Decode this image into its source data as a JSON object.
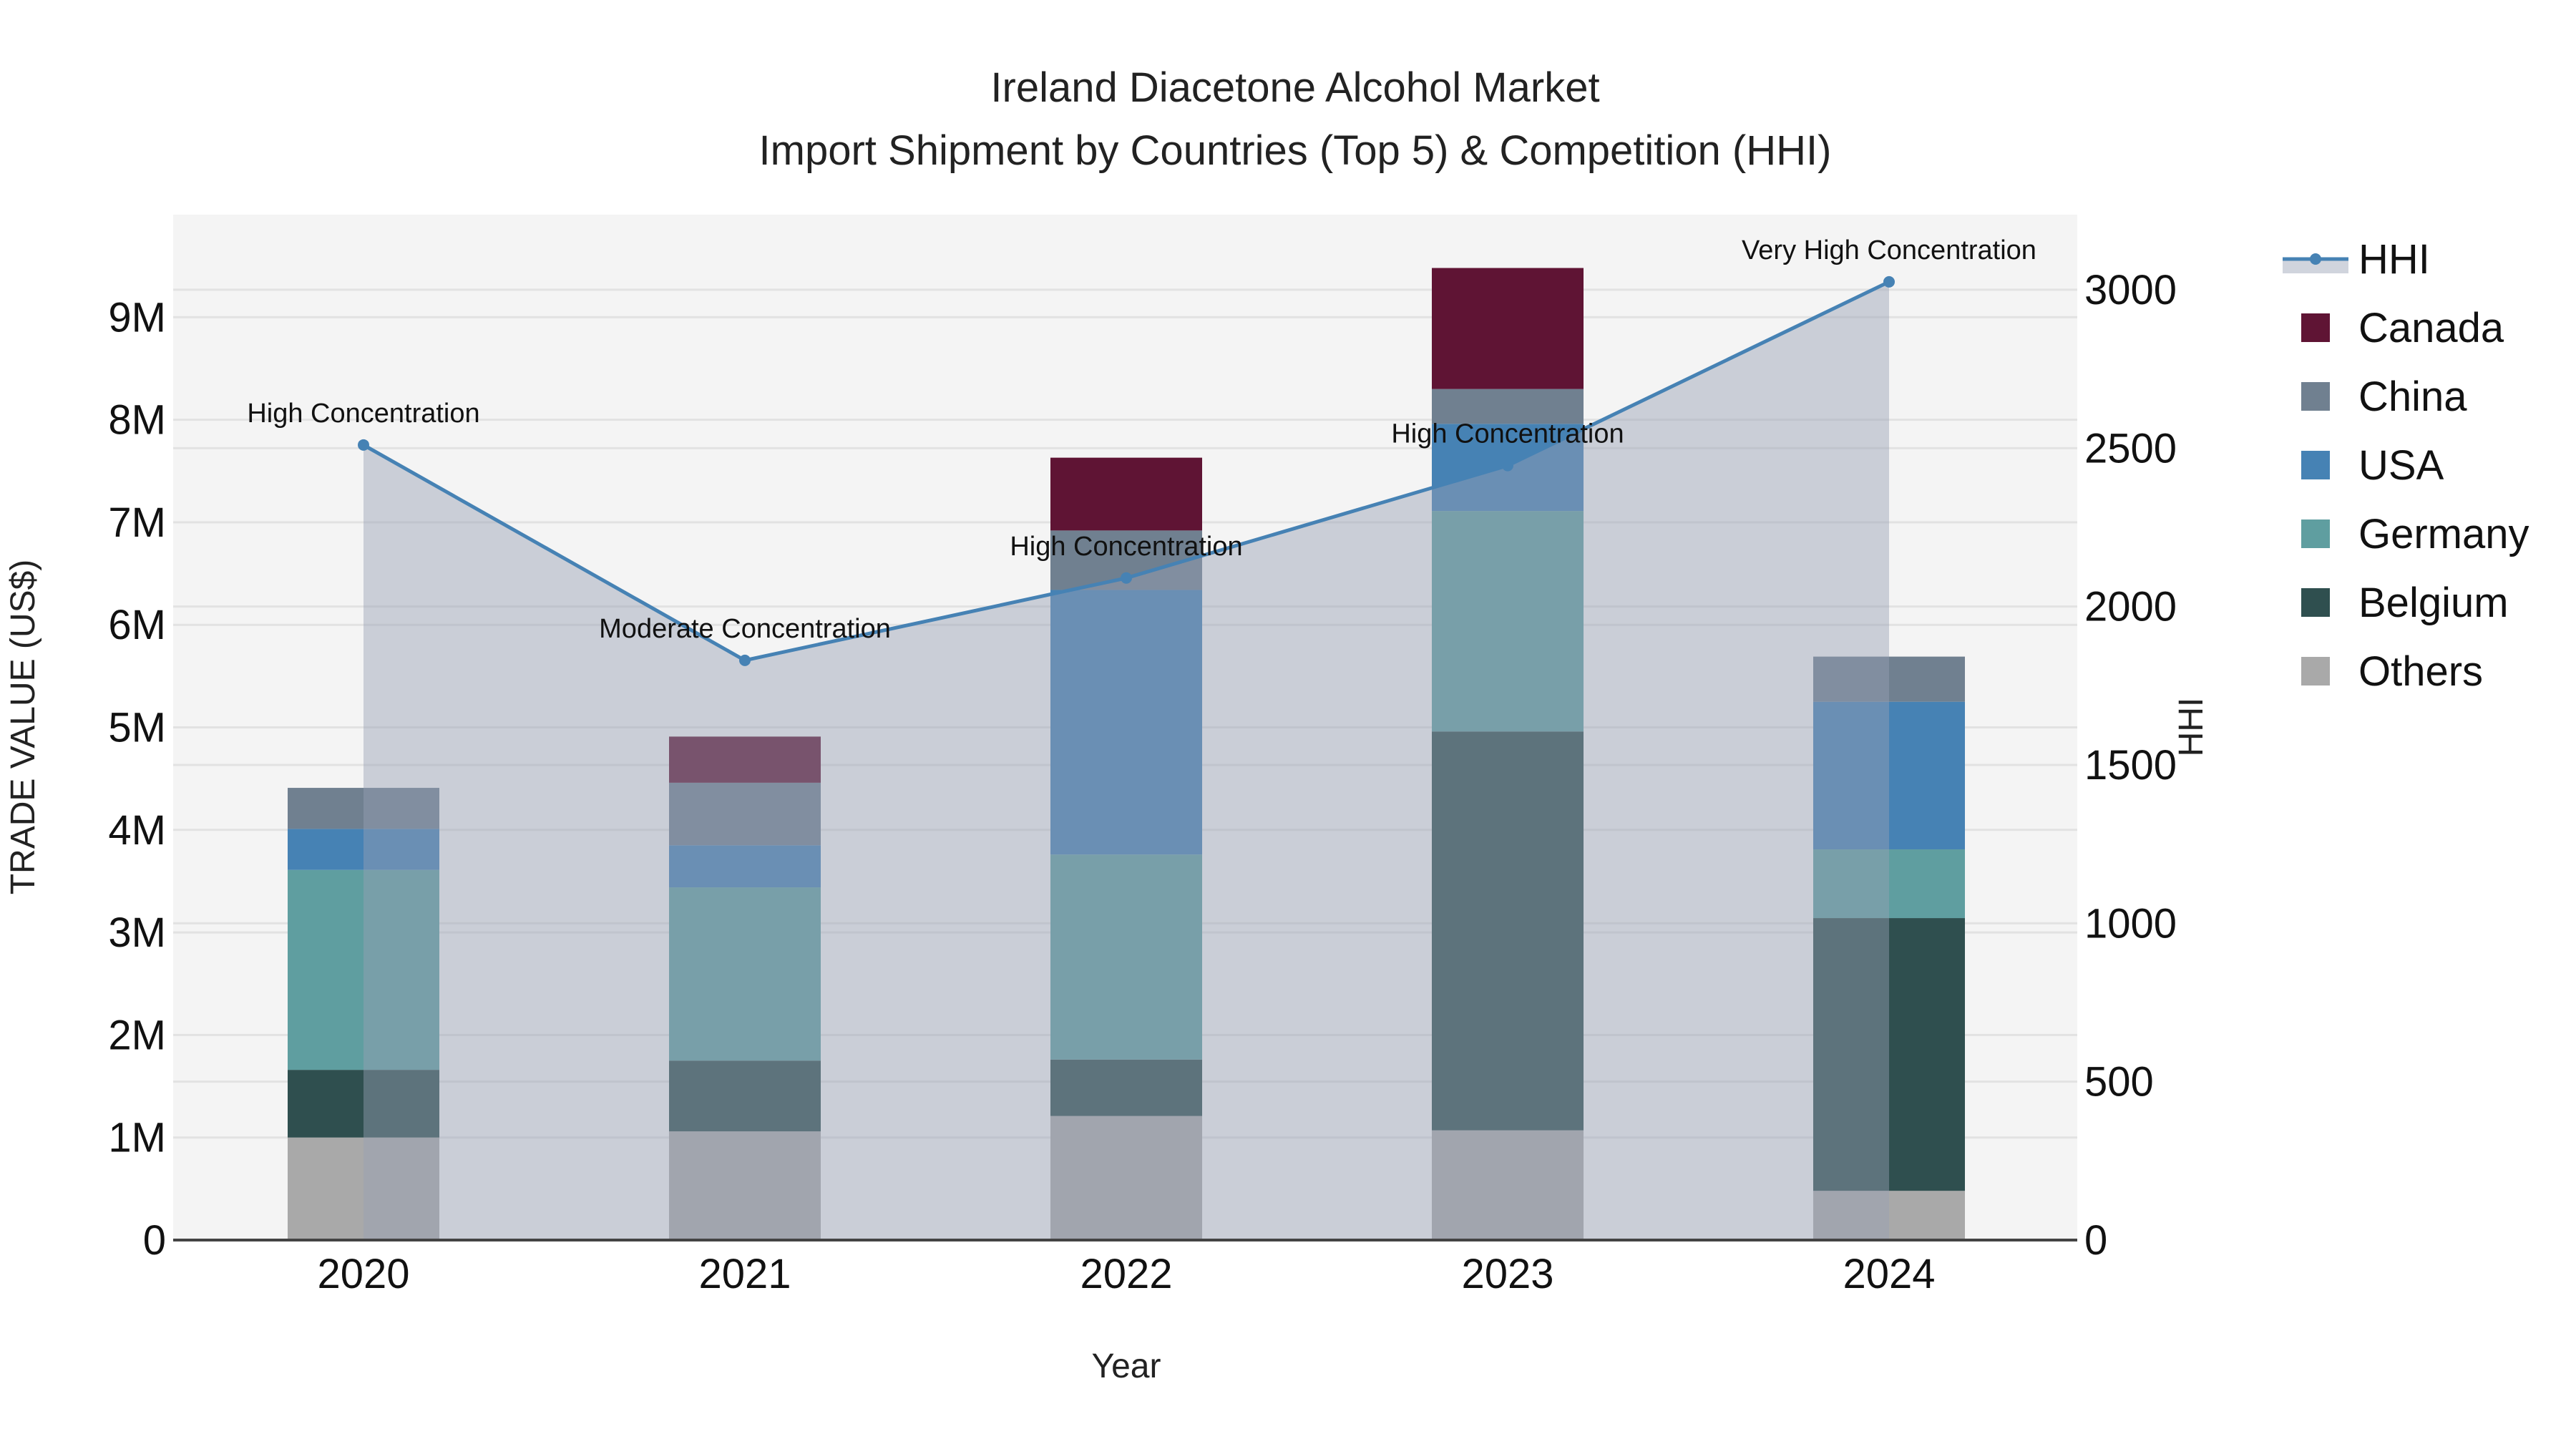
{
  "chart_data": {
    "type": "bar",
    "title": "Ireland Diacetone Alcohol Market",
    "subtitle": "Import Shipment by Countries (Top 5) & Competition (HHI)",
    "xlabel": "Year",
    "ylabel": "TRADE VALUE (US$)",
    "y2label": "HHI",
    "categories": [
      "2020",
      "2021",
      "2022",
      "2023",
      "2024"
    ],
    "ylim": [
      0,
      10000000
    ],
    "y2lim": [
      0,
      3237
    ],
    "yticks": [
      0,
      1000000,
      2000000,
      3000000,
      4000000,
      5000000,
      6000000,
      7000000,
      8000000,
      9000000
    ],
    "ytick_labels": [
      "0",
      "1M",
      "2M",
      "3M",
      "4M",
      "5M",
      "6M",
      "7M",
      "8M",
      "9M"
    ],
    "y2ticks": [
      0,
      500,
      1000,
      1500,
      2000,
      2500,
      3000
    ],
    "y2tick_labels": [
      "0",
      "500",
      "1000",
      "1500",
      "2000",
      "2500",
      "3000"
    ],
    "stacked": true,
    "series": [
      {
        "name": "Others",
        "color": "#a9a9a9",
        "values": [
          1000000,
          1060000,
          1210000,
          1070000,
          480000
        ]
      },
      {
        "name": "Belgium",
        "color": "#2f4f4f",
        "values": [
          660000,
          690000,
          550000,
          3890000,
          2660000
        ]
      },
      {
        "name": "Germany",
        "color": "#5f9ea0",
        "values": [
          1950000,
          1690000,
          2000000,
          2150000,
          670000
        ]
      },
      {
        "name": "USA",
        "color": "#4682b4",
        "values": [
          400000,
          410000,
          2580000,
          850000,
          1440000
        ]
      },
      {
        "name": "China",
        "color": "#708090",
        "values": [
          400000,
          610000,
          580000,
          340000,
          440000
        ]
      },
      {
        "name": "Canada",
        "color": "#5f1434",
        "values": [
          0,
          450000,
          710000,
          1180000,
          0
        ]
      }
    ],
    "line": {
      "name": "HHI",
      "color": "#4682b4",
      "values": [
        2510,
        1830,
        2090,
        2445,
        3025
      ],
      "annotations": [
        "High Concentration",
        "Moderate Concentration",
        "High Concentration",
        "High Concentration",
        "Very High Concentration"
      ]
    },
    "legend_order": [
      "HHI",
      "Canada",
      "China",
      "USA",
      "Germany",
      "Belgium",
      "Others"
    ],
    "legend_placement": "right",
    "grid": true
  }
}
